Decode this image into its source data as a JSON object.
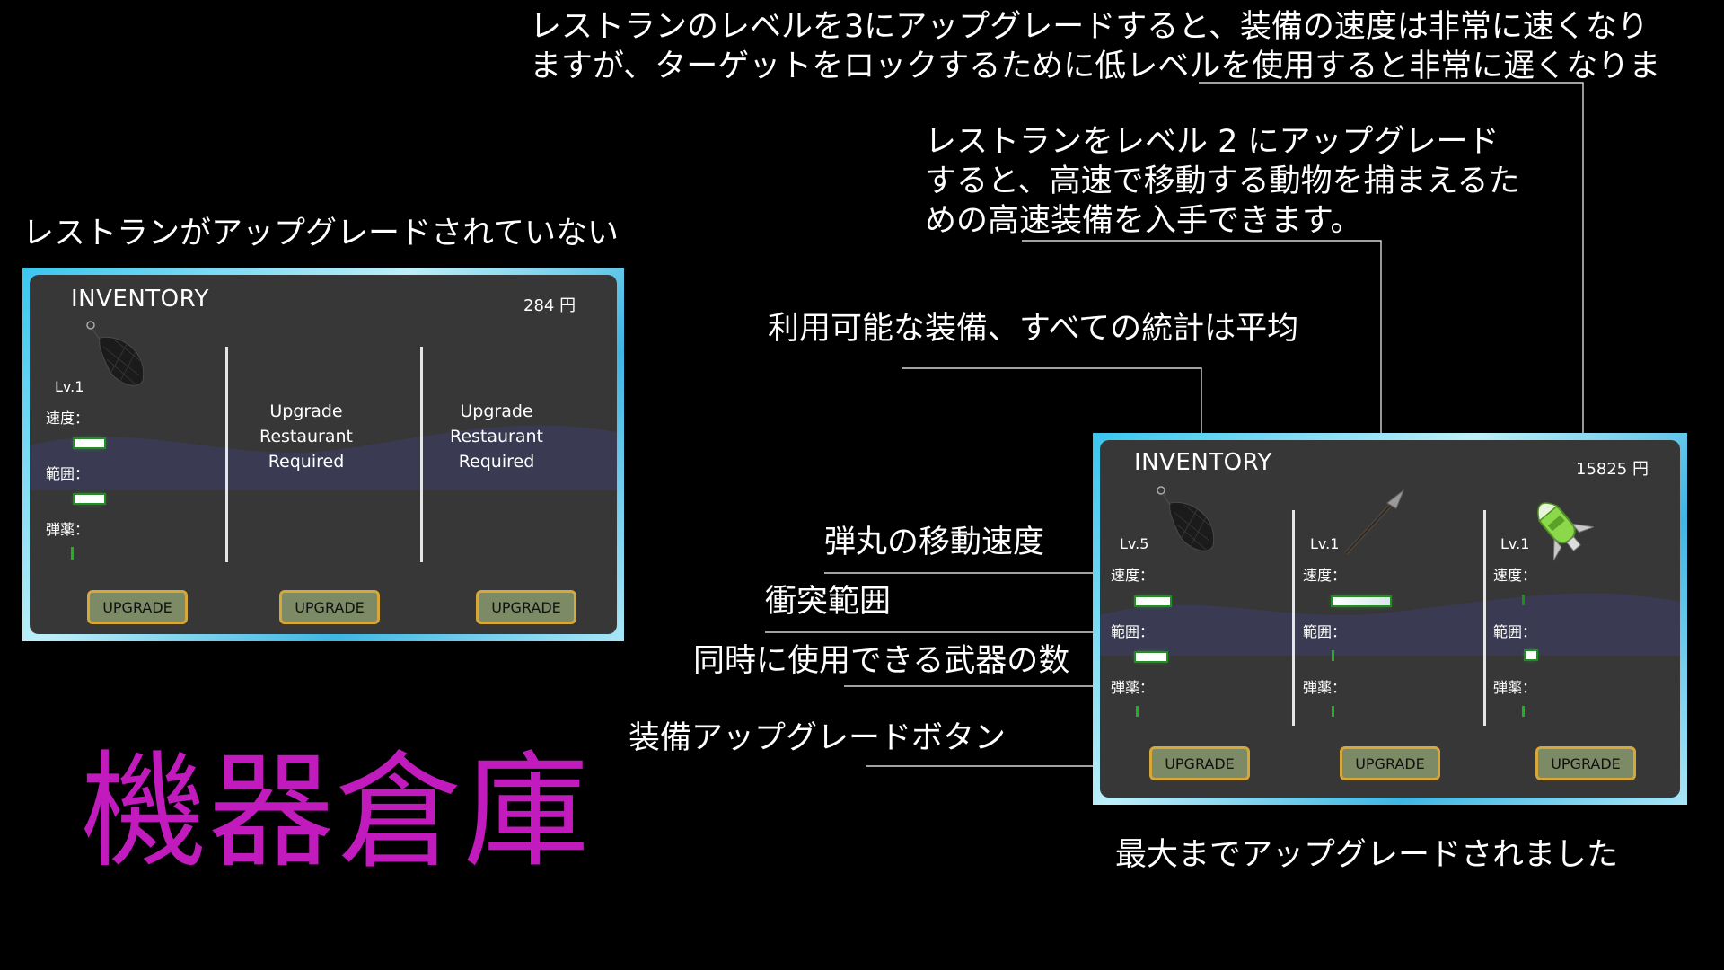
{
  "annotations": {
    "level3_upgrade": "レストランのレベルを3にアップグレードすると、装備の速度は非常に速くなり",
    "level3_upgrade_cont": "ますが、ターゲットをロックするために低レベルを使用すると非常に遅くなりま",
    "level2_upgrade_1": "レストランをレベル 2 にアップグレード",
    "level2_upgrade_2": "すると、高速で移動する動物を捕まえるた",
    "level2_upgrade_3": "めの高速装備を入手できます。",
    "available_equipment": "利用可能な装備、すべての統計は平均",
    "not_upgraded": "レストランがアップグレードされていない",
    "bullet_speed": "弾丸の移動速度",
    "collision_range": "衝突範囲",
    "weapon_count": "同時に使用できる武器の数",
    "upgrade_button_note": "装備アップグレードボタン",
    "max_upgraded": "最大までアップグレードされました",
    "main_title": "機器倉庫"
  },
  "left_panel": {
    "title": "INVENTORY",
    "money": "284 円",
    "slots": [
      {
        "level": "Lv.1",
        "speed_label": "速度：",
        "range_label": "範囲：",
        "ammo_label": "弾薬：",
        "button": "UPGRADE",
        "item_icon": "net-icon"
      },
      {
        "upgrade_line1": "Upgrade",
        "upgrade_line2": "Restaurant",
        "upgrade_line3": "Required",
        "button": "UPGRADE"
      },
      {
        "upgrade_line1": "Upgrade",
        "upgrade_line2": "Restaurant",
        "upgrade_line3": "Required",
        "button": "UPGRADE"
      }
    ]
  },
  "right_panel": {
    "title": "INVENTORY",
    "money": "15825 円",
    "slots": [
      {
        "level": "Lv.5",
        "speed_label": "速度：",
        "range_label": "範囲：",
        "ammo_label": "弾薬：",
        "button": "UPGRADE",
        "item_icon": "net-icon"
      },
      {
        "level": "Lv.1",
        "speed_label": "速度：",
        "range_label": "範囲：",
        "ammo_label": "弾薬：",
        "button": "UPGRADE",
        "item_icon": "spear-icon"
      },
      {
        "level": "Lv.1",
        "speed_label": "速度：",
        "range_label": "範囲：",
        "ammo_label": "弾薬：",
        "button": "UPGRADE",
        "item_icon": "rocket-icon"
      }
    ]
  },
  "colors": {
    "title_magenta": "#c21bbd",
    "panel_border": "#39c6ef",
    "panel_bg": "#373737",
    "button_bg": "#7c8a66",
    "button_border": "#d6a83b",
    "stat_glow": "#1fb31f"
  }
}
